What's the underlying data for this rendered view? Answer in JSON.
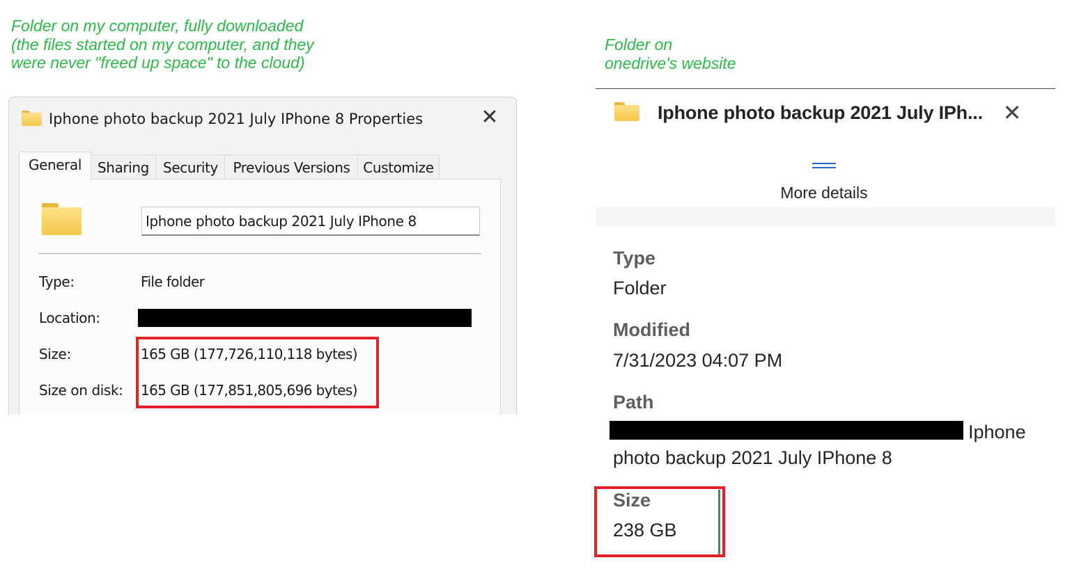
{
  "captions": {
    "left": "Folder on my computer, fully downloaded\n(the files started on my computer, and they\nwere never \"freed up space\" to the cloud)",
    "right": "Folder on\nonedrive's website"
  },
  "properties_dialog": {
    "title": "Iphone photo backup 2021 July IPhone 8 Properties",
    "close_glyph": "✕",
    "tabs": [
      "General",
      "Sharing",
      "Security",
      "Previous Versions",
      "Customize"
    ],
    "active_tab": "General",
    "folder_name": "Iphone photo backup 2021 July IPhone 8",
    "rows": {
      "type": {
        "label": "Type:",
        "value": "File folder"
      },
      "location": {
        "label": "Location:",
        "value": ""
      },
      "size": {
        "label": "Size:",
        "value": "165 GB (177,726,110,118 bytes)"
      },
      "size_on_disk": {
        "label": "Size on disk:",
        "value": "165 GB (177,851,805,696 bytes)"
      }
    },
    "icons": {
      "folder": "folder-icon",
      "close": "close-icon"
    },
    "highlight_color": "#e4202b"
  },
  "onedrive_details": {
    "title": "Iphone photo backup 2021 July IPh...",
    "close_glyph": "✕",
    "more_details": "More details",
    "type": {
      "label": "Type",
      "value": "Folder"
    },
    "modified": {
      "label": "Modified",
      "value": "7/31/2023 04:07 PM"
    },
    "path": {
      "label": "Path",
      "value_line1": "Iphone",
      "value_line2": "photo backup 2021 July IPhone 8"
    },
    "size": {
      "label": "Size",
      "value": "238 GB"
    },
    "accent_color": "#2564cf",
    "highlight_color": "#e4202b"
  }
}
